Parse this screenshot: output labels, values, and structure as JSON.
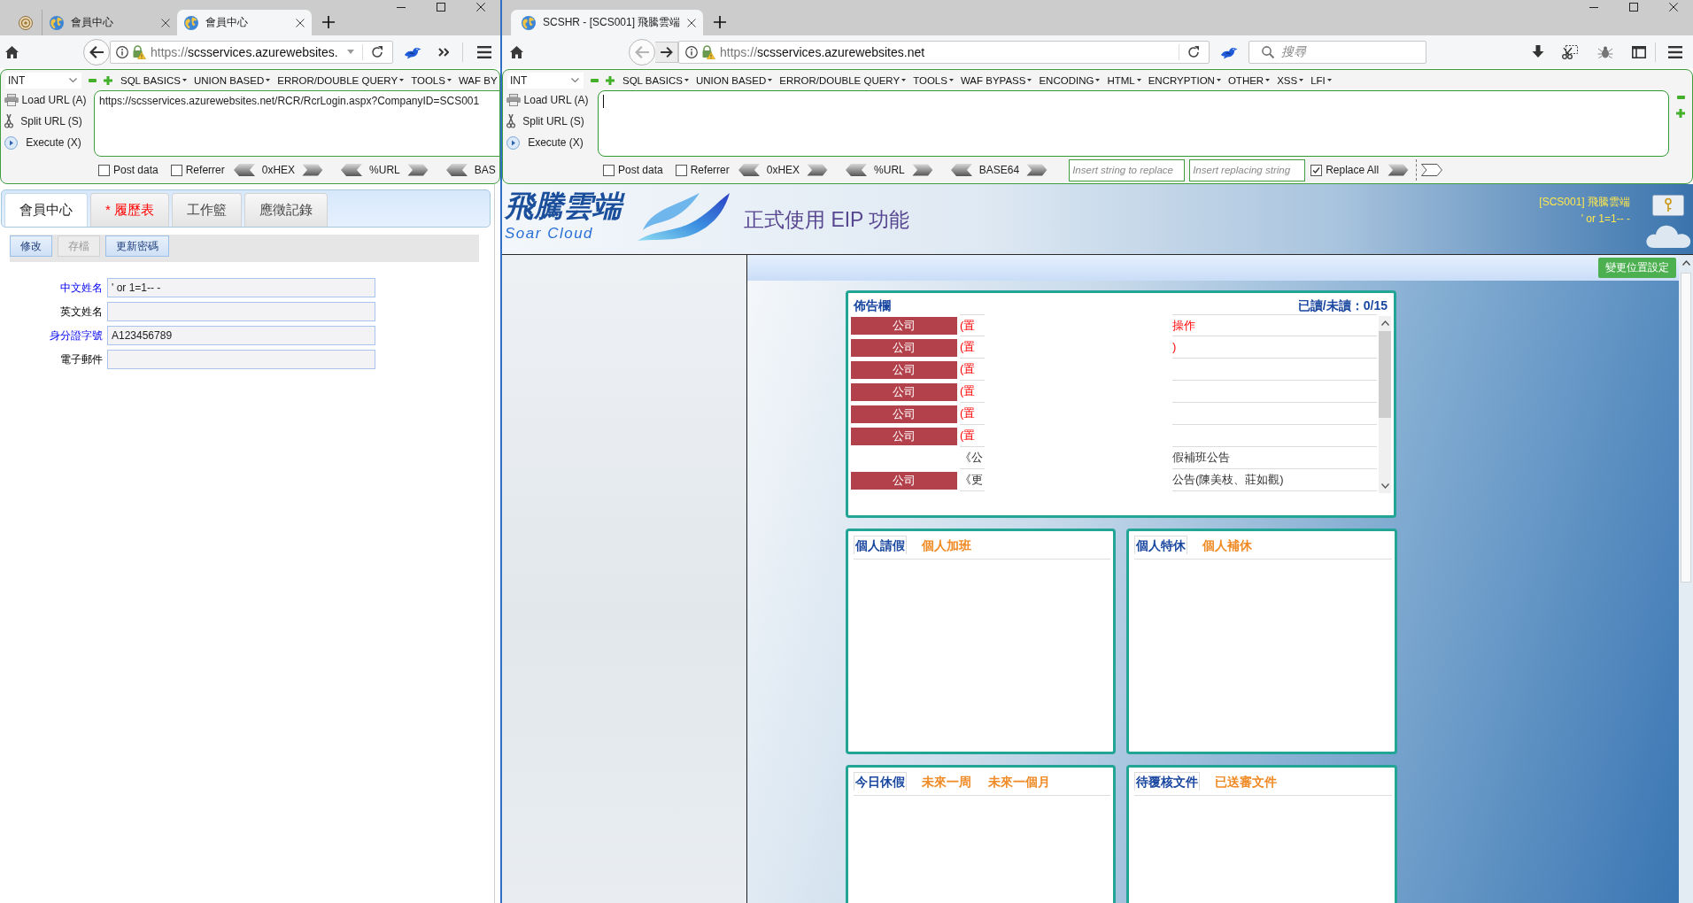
{
  "left_window": {
    "tabs": [
      {
        "kind": "pinned",
        "selected": false
      },
      {
        "kind": "page",
        "title": "會員中心",
        "selected": false
      },
      {
        "kind": "page",
        "title": "會員中心",
        "selected": true
      }
    ],
    "back_button": {
      "disabled": false
    },
    "address": {
      "scheme": "https://",
      "host": "scsservices.azurewebsites."
    },
    "hackbar": {
      "encoding": "INT",
      "menus": [
        "SQL BASICS",
        "UNION BASED",
        "ERROR/DOUBLE QUERY",
        "TOOLS",
        "WAF BY"
      ],
      "actions": [
        {
          "kind": "load",
          "label": "Load URL (A)"
        },
        {
          "kind": "split",
          "label": "Split URL (S)"
        },
        {
          "kind": "execute",
          "label": "Execute (X)"
        }
      ],
      "url": "https://scsservices.azurewebsites.net/RCR/RcrLogin.aspx?CompanyID=SCS001",
      "focused": false,
      "options": [
        {
          "label": "Post data",
          "checked": false
        },
        {
          "label": "Referrer",
          "checked": false
        }
      ],
      "encoders": [
        "0xHEX",
        "%URL",
        "BAS"
      ]
    },
    "page": {
      "tabs": [
        {
          "label": "會員中心",
          "selected": true,
          "marked": false
        },
        {
          "label": "* 履歷表",
          "selected": false,
          "marked": true
        },
        {
          "label": "工作籃",
          "selected": false,
          "marked": false
        },
        {
          "label": "應徵記錄",
          "selected": false,
          "marked": false
        }
      ],
      "buttons": [
        {
          "label": "修改",
          "disabled": false
        },
        {
          "label": "存檔",
          "disabled": true
        },
        {
          "label": "更新密碼",
          "disabled": false
        }
      ],
      "fields": [
        {
          "label": "中文姓名",
          "highlighted": true,
          "value": "' or 1=1-- -"
        },
        {
          "label": "英文姓名",
          "highlighted": false
        },
        {
          "label": "身分證字號",
          "highlighted": true,
          "value": "A123456789"
        },
        {
          "label": "電子郵件",
          "highlighted": false
        }
      ]
    }
  },
  "right_window": {
    "tabs": [
      {
        "kind": "page",
        "title": "SCSHR - [SCS001] 飛騰雲端",
        "selected": true
      }
    ],
    "back_button": {
      "disabled": true
    },
    "forward_button": {
      "disabled": false
    },
    "address": {
      "scheme": "https://",
      "host": "scsservices.azurewebsites.net"
    },
    "search": {
      "placeholder": "搜尋"
    },
    "hackbar": {
      "encoding": "INT",
      "menus": [
        "SQL BASICS",
        "UNION BASED",
        "ERROR/DOUBLE QUERY",
        "TOOLS",
        "WAF BYPASS",
        "ENCODING",
        "HTML",
        "ENCRYPTION",
        "OTHER",
        "XSS",
        "LFI"
      ],
      "actions": [
        {
          "kind": "load",
          "label": "Load URL (A)"
        },
        {
          "kind": "split",
          "label": "Split URL (S)"
        },
        {
          "kind": "execute",
          "label": "Execute (X)"
        }
      ],
      "focused": true,
      "options": [
        {
          "label": "Post data",
          "checked": false
        },
        {
          "label": "Referrer",
          "checked": false
        }
      ],
      "encoders": [
        "0xHEX",
        "%URL",
        "BASE64"
      ],
      "replace": {
        "find_placeholder": "Insert string to replace",
        "replace_placeholder": "Insert replacing string",
        "replace_all": {
          "label": "Replace All",
          "checked": true
        }
      }
    },
    "page": {
      "banner": {
        "logo_title": "飛騰雲端",
        "logo_subtitle": "Soar Cloud",
        "headline": "正式使用 EIP 功能",
        "company": "[SCS001] 飛騰雲端",
        "user": "' or 1=1-- -"
      },
      "location_button": "變更位置設定",
      "bulletin": {
        "title": "佈告欄",
        "read_count": "已讀/未讀：0/15",
        "rows": [
          {
            "badge": "公司",
            "pinned": true,
            "column_2": "(置",
            "column_3": "操作"
          },
          {
            "badge": "公司",
            "pinned": true,
            "column_2": "(置",
            "column_3": ")"
          },
          {
            "badge": "公司",
            "pinned": true,
            "column_2": "(置"
          },
          {
            "badge": "公司",
            "pinned": true,
            "column_2": "(置"
          },
          {
            "badge": "公司",
            "pinned": true,
            "column_2": "(置"
          },
          {
            "badge": "公司",
            "pinned": true,
            "column_2": "(置"
          },
          {
            "pinned": false,
            "column_2": "《公",
            "column_3": "假補班公告"
          },
          {
            "badge": "公司",
            "pinned": false,
            "column_2": "《更",
            "column_3": "公告(陳美枝、莊如觀)"
          }
        ]
      },
      "panels": [
        {
          "tabs": [
            {
              "label": "個人請假",
              "selected": true
            },
            {
              "label": "個人加班",
              "selected": false
            }
          ]
        },
        {
          "tabs": [
            {
              "label": "個人特休",
              "selected": true
            },
            {
              "label": "個人補休",
              "selected": false
            }
          ]
        },
        {
          "tabs": [
            {
              "label": "今日休假",
              "selected": true
            },
            {
              "label": "未來一周",
              "selected": false
            },
            {
              "label": "未來一個月",
              "selected": false
            }
          ]
        },
        {
          "tabs": [
            {
              "label": "待覆核文件",
              "selected": true
            },
            {
              "label": "已送審文件",
              "selected": false
            }
          ]
        }
      ]
    }
  }
}
